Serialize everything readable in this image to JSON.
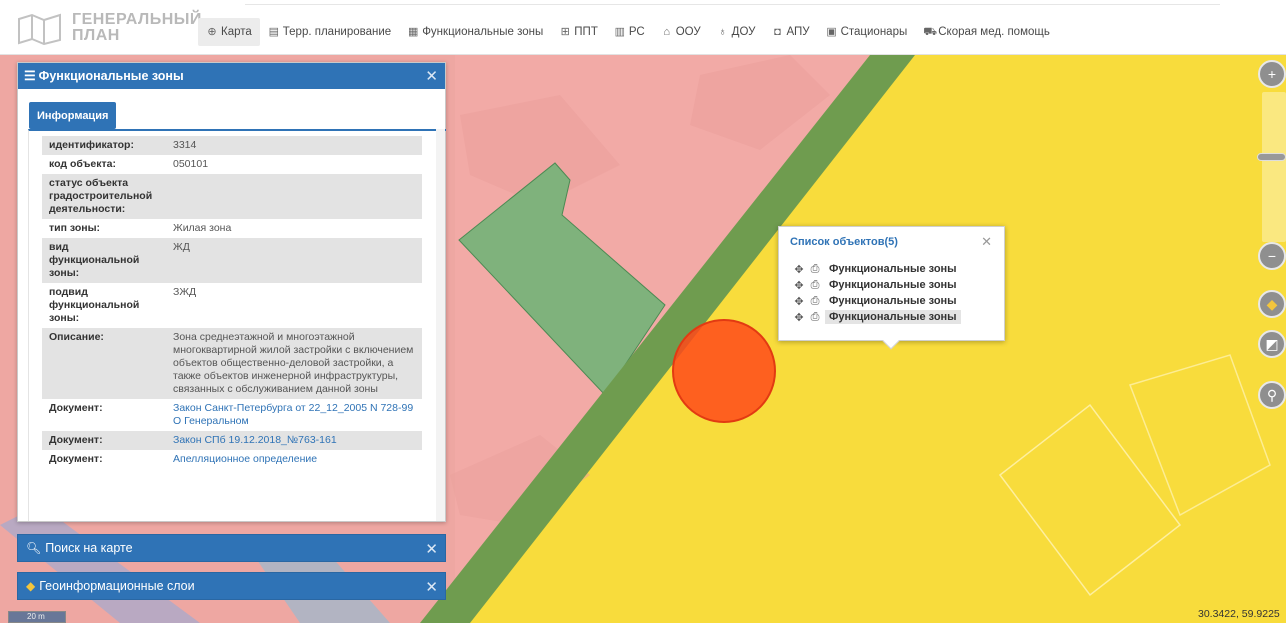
{
  "header": {
    "logo_line1": "ГЕНЕРАЛЬНЫЙ",
    "logo_line2": "ПЛАН",
    "nav": [
      {
        "label": "Карта",
        "icon": "globe-icon",
        "active": true
      },
      {
        "label": "Терр. планирование",
        "icon": "document-icon",
        "active": false
      },
      {
        "label": "Функциональные зоны",
        "icon": "list-icon",
        "active": false
      },
      {
        "label": "ППТ",
        "icon": "table-icon",
        "active": false
      },
      {
        "label": "РС",
        "icon": "grid-icon",
        "active": false
      },
      {
        "label": "ООУ",
        "icon": "building-icon",
        "active": false
      },
      {
        "label": "ДОУ",
        "icon": "child-icon",
        "active": false
      },
      {
        "label": "АПУ",
        "icon": "frame-icon",
        "active": false
      },
      {
        "label": "Стационары",
        "icon": "hospital-icon",
        "active": false
      },
      {
        "label": "Скорая мед. помощь",
        "icon": "ambulance-icon",
        "active": false
      }
    ]
  },
  "panel": {
    "title": "Функциональные зоны",
    "tab_label": "Информация",
    "rows": [
      {
        "key": "идентификатор:",
        "value": "3314"
      },
      {
        "key": "код объекта:",
        "value": "050101"
      },
      {
        "key": "статус объекта градостроительной деятельности:",
        "value": ""
      },
      {
        "key": "тип зоны:",
        "value": "Жилая зона"
      },
      {
        "key": "вид функциональной зоны:",
        "value": "ЖД"
      },
      {
        "key": "подвид функциональной зоны:",
        "value": "ЗЖД"
      },
      {
        "key": "Описание:",
        "value": "Зона среднеэтажной и многоэтажной многоквартирной жилой застройки с включением объектов общественно-деловой застройки, а также объектов инженерной инфраструктуры, связанных с обслуживанием данной зоны"
      },
      {
        "key": "Документ:",
        "value": "Закон Санкт-Петербурга от 22_12_2005 N 728-99 О Генеральном"
      },
      {
        "key": "Документ:",
        "value": "Закон СПб 19.12.2018_№763-161"
      },
      {
        "key": "Документ:",
        "value": "Апелляционное определение"
      }
    ]
  },
  "search_bar": {
    "title": "Поиск на карте"
  },
  "layers_bar": {
    "title": "Геоинформационные слои"
  },
  "popup": {
    "title": "Список объектов(5)",
    "items": [
      {
        "label": "Функциональные зоны"
      },
      {
        "label": "Функциональные зоны"
      },
      {
        "label": "Функциональные зоны"
      },
      {
        "label": "Функциональные зоны"
      }
    ]
  },
  "map": {
    "scale_label": "20 m",
    "coordinates": "30.3422, 59.9225",
    "colors": {
      "residential_pink": "#f2aaa6",
      "business_pink": "#e99e9a",
      "park_green": "#7fb27c",
      "road_green": "#6f9c4f",
      "yellow_zone": "#f8dc3c",
      "marker_red": "#ff4a1a",
      "accent_blue": "#2f73b6"
    }
  }
}
